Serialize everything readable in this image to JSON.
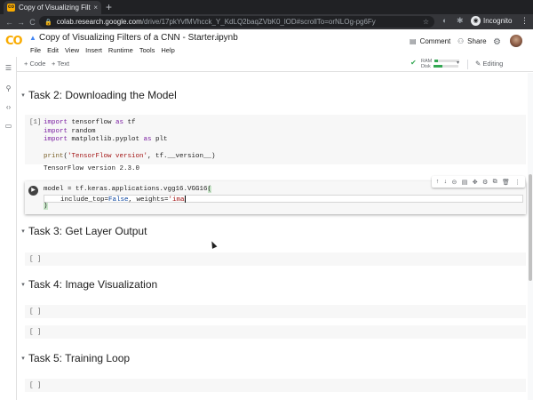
{
  "browser": {
    "tab_title": "Copy of Visualizing Filters",
    "tab_close": "×",
    "new_tab": "+",
    "nav": {
      "back": "←",
      "forward": "→",
      "reload": "C"
    },
    "lock": "🔒",
    "url_host": "colab.research.google.com",
    "url_path": "/drive/17pkYvfMVhcck_Y_KdLQ2baqZVbK0_lOD#scrollTo=orNLOg-pg6Fy",
    "omnibox_icons": "☆",
    "incognito_icon": "◉",
    "incognito_label": "Incognito",
    "menu_icon": "⋮"
  },
  "header": {
    "logo": "CO",
    "drive_icon": "▲",
    "doc_title": "Copy of Visualizing Filters of a CNN - Starter.ipynb",
    "star": "☆",
    "menu": [
      "File",
      "Edit",
      "View",
      "Insert",
      "Runtime",
      "Tools",
      "Help"
    ],
    "comment_icon": "▤",
    "comment_label": "Comment",
    "share_icon": "⚇",
    "share_label": "Share",
    "gear_icon": "⚙"
  },
  "toolbar": {
    "add_code": "+ Code",
    "add_text": "+ Text",
    "ram_check": "✔",
    "ram_label": "RAM",
    "disk_label": "Disk",
    "ram_fill": 0.15,
    "disk_fill": 0.35,
    "dropdown": "▾",
    "editing_icon": "✎",
    "editing_label": "Editing"
  },
  "sidebar": {
    "icons": [
      "☰",
      "⚲",
      "‹›",
      "▭"
    ]
  },
  "sections": {
    "task2": "Task 2: Downloading the Model",
    "task3": "Task 3: Get Layer Output",
    "task4": "Task 4: Image Visualization",
    "task5": "Task 5: Training Loop",
    "caret": "▾"
  },
  "cell1": {
    "prompt": "[1]",
    "lines": {
      "l1_kw": "import",
      "l1_rest": " tensorflow ",
      "l1_as": "as",
      "l1_alias": " tf",
      "l2_kw": "import",
      "l2_rest": " random",
      "l3_kw": "import",
      "l3_rest": " matplotlib.pyplot ",
      "l3_as": "as",
      "l3_alias": " plt",
      "l4_fn": "print",
      "l4_open": "(",
      "l4_str": "'TensorFlow version'",
      "l4_rest": ", tf.__version__)"
    },
    "output": "TensorFlow version 2.3.0"
  },
  "cell2": {
    "run_icon": "▶",
    "line1_a": "model = tf.keras.applications.vgg16.VGG16",
    "line1_b": "(",
    "line2_indent": "    include_top=",
    "line2_false": "False",
    "line2_mid": ", weights=",
    "line2_str": "'ima",
    "line3": ")",
    "toolbar_icons": [
      "↑",
      "↓",
      "⊝",
      "▤",
      "✥",
      "⚙",
      "⧉",
      "🗑",
      "⋮"
    ]
  },
  "empty_cells": {
    "prompt": "[ ]"
  }
}
